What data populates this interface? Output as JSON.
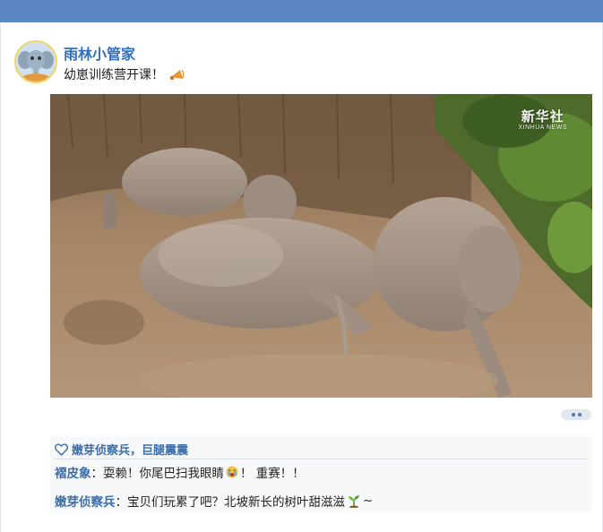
{
  "header": {
    "accent_color": "#5b87c4"
  },
  "post": {
    "username": "雨林小管家",
    "text": "幼崽训练营开课！",
    "text_icon": "horn-icon",
    "image_watermark_cn": "新华社",
    "image_watermark_en": "XINHUA NEWS"
  },
  "likes": {
    "icon": "heart-icon",
    "text": "嫩芽侦察兵，巨腿震震"
  },
  "comments": [
    {
      "author": "褶皮象",
      "text_before": "耍赖！你尾巴扫我眼睛",
      "emoji": "crying-face-icon",
      "text_after": "！ 重赛！！"
    },
    {
      "author": "嫩芽侦察兵",
      "text_before": "宝贝们玩累了吧？北坡新长的树叶甜滋滋",
      "emoji": "sprout-icon",
      "text_after": " ~"
    }
  ]
}
